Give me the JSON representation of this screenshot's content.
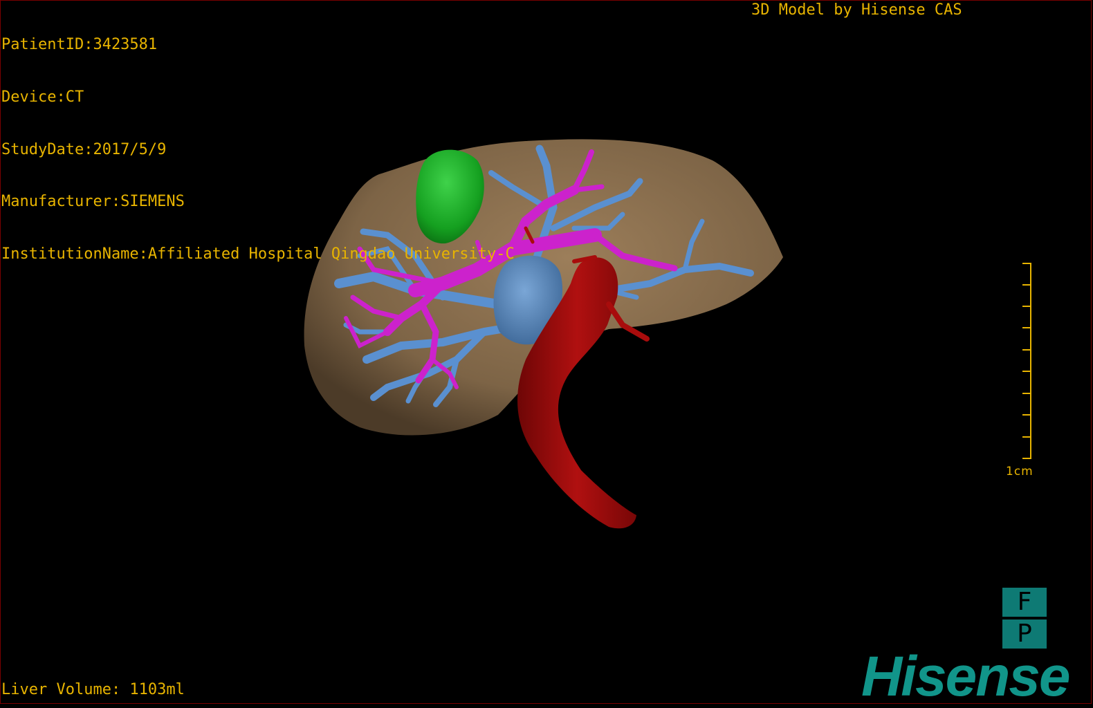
{
  "header": {
    "patient_id": "PatientID:3423581",
    "device": "Device:CT",
    "study_date": "StudyDate:2017/5/9",
    "manufacturer": "Manufacturer:SIEMENS",
    "institution": "InstitutionName:Affiliated Hospital Qingdao University-C",
    "model_title": "3D Model by Hisense CAS"
  },
  "footer": {
    "liver_volume": "Liver Volume: 1103ml"
  },
  "scale_bar": {
    "label": "1cm"
  },
  "orientation": {
    "top": "F",
    "bottom": "P"
  },
  "brand": {
    "logo_text": "Hisense"
  },
  "colors": {
    "overlay_text": "#e8b400",
    "liver": "#8a6e4e",
    "tumor": "#1aa52a",
    "portal_vein": "#cc22cc",
    "hepatic_vein": "#5a90d0",
    "vena_cava": "#5c86b8",
    "artery_aorta": "#a80c0c",
    "brand": "#11958a"
  }
}
